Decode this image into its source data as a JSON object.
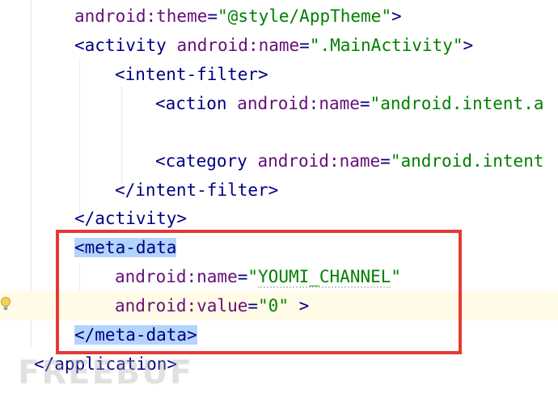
{
  "editor": {
    "lines": {
      "theme": {
        "attr": "android:theme",
        "eq": "=",
        "value": "\"@style/AppTheme\"",
        "close": ">"
      },
      "activity_open": {
        "tag": "<activity",
        "attr": "android:name",
        "eq": "=",
        "value": "\".MainActivity\"",
        "close": ">"
      },
      "intent_filter_open": {
        "tag": "<intent-filter>"
      },
      "action": {
        "tag": "<action",
        "attr": "android:name",
        "eq": "=",
        "value": "\"android.intent.a"
      },
      "category": {
        "tag": "<category",
        "attr": "android:name",
        "eq": "=",
        "value": "\"android.intent"
      },
      "intent_filter_close": {
        "tag": "</intent-filter>"
      },
      "activity_close": {
        "tag": "</activity>"
      },
      "meta_data_open": {
        "tag": "<meta-data"
      },
      "meta_name": {
        "attr": "android:name",
        "eq": "=",
        "q_open": "\"",
        "value": "YOUMI_CHANNEL",
        "q_close": "\""
      },
      "meta_value": {
        "attr": "android:value",
        "eq": "=",
        "value": "\"0\"",
        "close": " >"
      },
      "meta_data_close": {
        "tag": "</meta-data>"
      },
      "application_close": {
        "tag": "</application>"
      }
    }
  },
  "watermark": {
    "text": "FREEBUF"
  },
  "colors": {
    "tag": "#000080",
    "attribute": "#660e7a",
    "value": "#008000",
    "highlight": "#b3d4fc",
    "annotation_box": "#e53935",
    "current_line": "#fffbe6"
  },
  "icons": {
    "gutter": "lightbulb-icon"
  }
}
